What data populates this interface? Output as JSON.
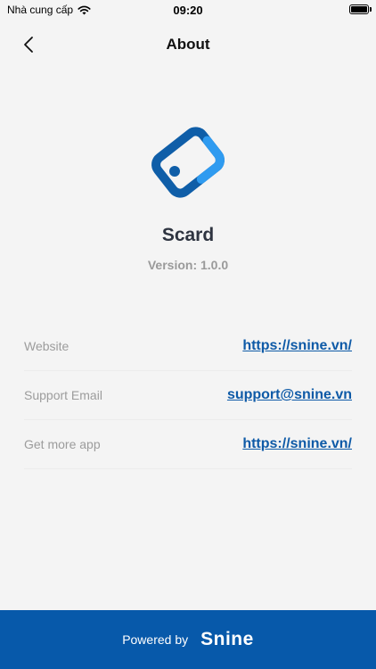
{
  "status_bar": {
    "carrier": "Nhà cung cấp",
    "time": "09:20",
    "battery_level": 1.0
  },
  "header": {
    "title": "About"
  },
  "app": {
    "name": "Scard",
    "version": "Version: 1.0.0"
  },
  "info_rows": [
    {
      "label": "Website",
      "value": "https://snine.vn/"
    },
    {
      "label": "Support Email",
      "value": "support@snine.vn"
    },
    {
      "label": "Get more app",
      "value": "https://snine.vn/"
    }
  ],
  "footer": {
    "powered_by": "Powered by",
    "brand": "Snine"
  },
  "colors": {
    "brand_blue": "#0759aa",
    "logo_blue": "#0f5ea8",
    "logo_accent": "#2f9bf0",
    "link": "#0e5aa7"
  }
}
